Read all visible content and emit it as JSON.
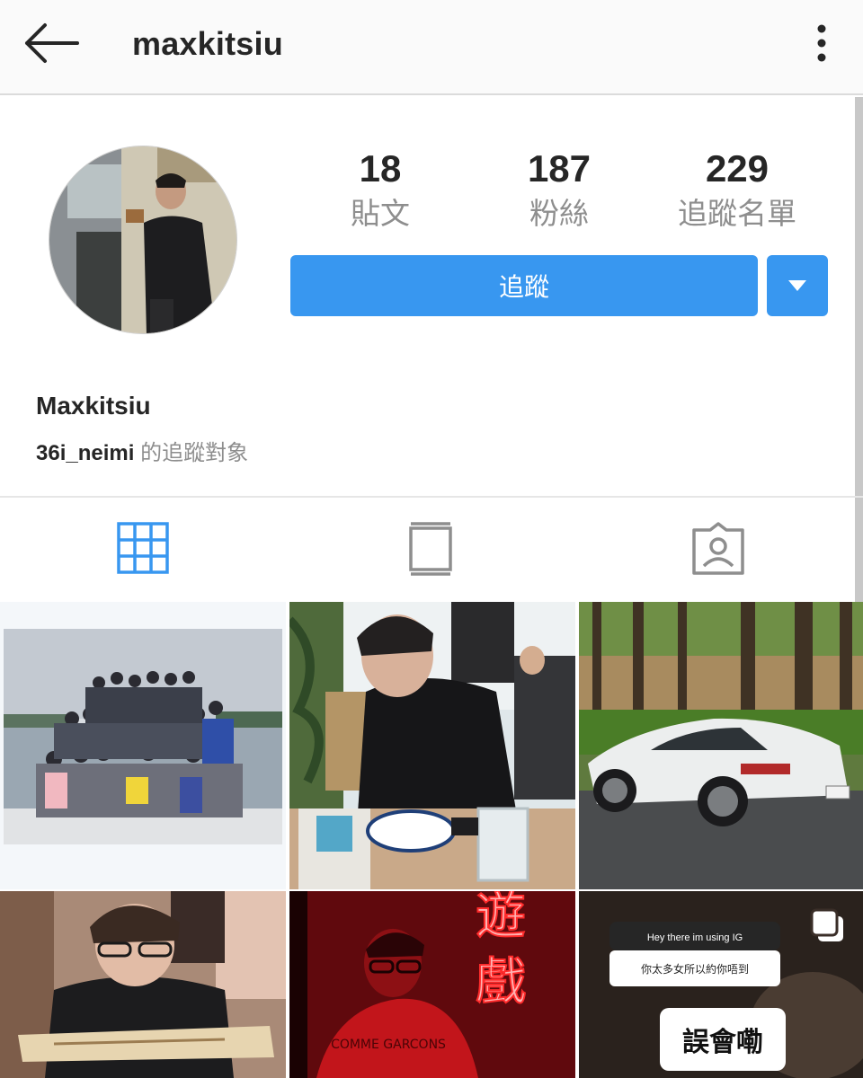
{
  "header": {
    "username": "maxkitsiu",
    "back_icon": "arrow-left-icon",
    "more_icon": "more-vertical-icon"
  },
  "profile": {
    "stats": [
      {
        "value": "18",
        "label": "貼文"
      },
      {
        "value": "187",
        "label": "粉絲"
      },
      {
        "value": "229",
        "label": "追蹤名單"
      }
    ],
    "follow_label": "追蹤",
    "display_name": "Maxkitsiu",
    "followed_by_account": "36i_neimi",
    "followed_by_suffix": "的追蹤對象"
  },
  "tabs": [
    {
      "icon": "grid-icon",
      "active": true
    },
    {
      "icon": "feed-icon",
      "active": false
    },
    {
      "icon": "tagged-icon",
      "active": false
    }
  ],
  "posts": [
    {
      "name": "group-boat-photo"
    },
    {
      "name": "man-at-table-photo"
    },
    {
      "name": "white-sports-car-photo"
    },
    {
      "name": "man-with-map-photo"
    },
    {
      "name": "red-neon-sign-photo",
      "neon_text": "遊 戲",
      "shirt_text": "COMME GARCONS"
    },
    {
      "name": "story-question-photo",
      "multi": true,
      "story_prompt": "Hey there im using IG",
      "story_answer": "你太多女所以約你唔到",
      "sticker_text": "誤會嘞"
    }
  ],
  "colors": {
    "accent": "#3897f0",
    "text": "#262626",
    "muted": "#8e8e8e"
  }
}
